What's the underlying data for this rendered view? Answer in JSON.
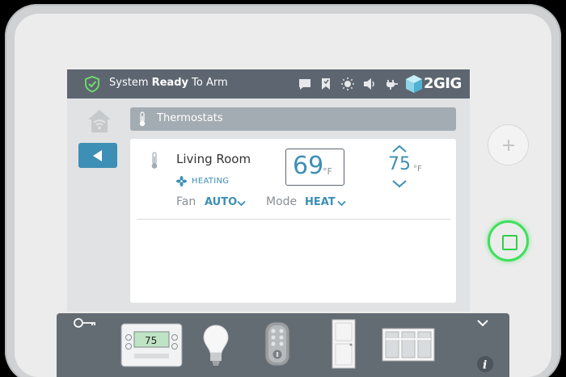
{
  "status_bar": {
    "prefix": "System ",
    "state": "Ready",
    "suffix": " To Arm",
    "icons": [
      "shield-check-icon",
      "message-icon",
      "bookmark-icon",
      "brightness-icon",
      "volume-icon",
      "plug-icon"
    ],
    "brand": "2GIG"
  },
  "nav": {
    "home_icon": "home-wifi-icon",
    "back_icon": "back-arrow-icon"
  },
  "section": {
    "title": "Thermostats",
    "icon": "thermometer-icon"
  },
  "thermostat": {
    "room": "Living Room",
    "status": "HEATING",
    "fan_label": "Fan",
    "fan_value": "AUTO",
    "mode_label": "Mode",
    "mode_value": "HEAT",
    "current_temp": "69",
    "current_unit": "°F",
    "set_temp": "75",
    "set_unit": "°F"
  },
  "tray": {
    "devices": [
      "thermostat",
      "smart-bulb",
      "door-lock",
      "door",
      "window"
    ],
    "thermostat_display": "75"
  },
  "colors": {
    "accent": "#3d8fb5",
    "status_bar": "#5d6670",
    "home_button_glow": "#3ee05a"
  }
}
